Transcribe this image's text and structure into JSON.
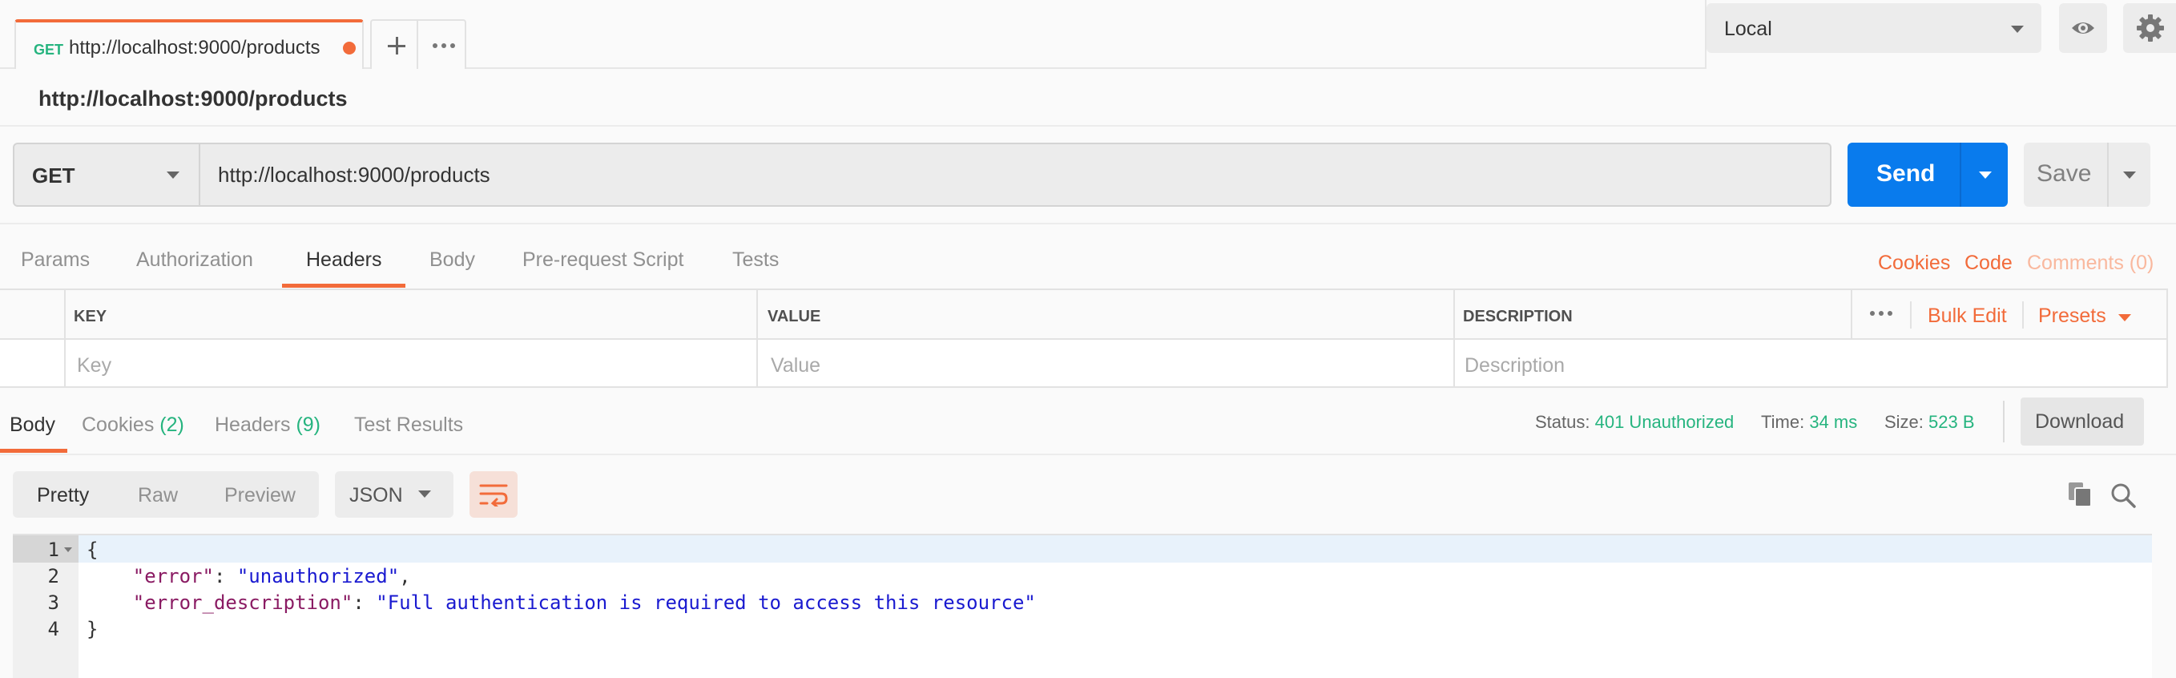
{
  "tab": {
    "method": "GET",
    "url": "http://localhost:9000/products"
  },
  "environment": {
    "selected": "Local"
  },
  "request": {
    "title": "http://localhost:9000/products",
    "method": "GET",
    "url": "http://localhost:9000/products",
    "send_label": "Send",
    "save_label": "Save"
  },
  "request_tabs": [
    "Params",
    "Authorization",
    "Headers",
    "Body",
    "Pre-request Script",
    "Tests"
  ],
  "request_links": {
    "cookies": "Cookies",
    "code": "Code",
    "comments": "Comments (0)"
  },
  "headers_table": {
    "columns": [
      "KEY",
      "VALUE",
      "DESCRIPTION"
    ],
    "placeholders": [
      "Key",
      "Value",
      "Description"
    ],
    "bulk_edit": "Bulk Edit",
    "presets": "Presets"
  },
  "response_tabs": {
    "body": "Body",
    "cookies": "Cookies",
    "cookies_count": "(2)",
    "headers": "Headers",
    "headers_count": "(9)",
    "tests": "Test Results"
  },
  "response_meta": {
    "status_label": "Status:",
    "status_value": "401 Unauthorized",
    "time_label": "Time:",
    "time_value": "34 ms",
    "size_label": "Size:",
    "size_value": "523 B",
    "download": "Download"
  },
  "view": {
    "options": [
      "Pretty",
      "Raw",
      "Preview"
    ],
    "format": "JSON"
  },
  "body_lines": {
    "n": [
      "1",
      "2",
      "3",
      "4"
    ],
    "open": "{",
    "close": "}",
    "k1": "\"error\"",
    "v1": "\"unauthorized\"",
    "k2": "\"error_description\"",
    "v2": "\"Full authentication is required to access this resource\""
  },
  "colors": {
    "accent": "#f26b3a",
    "send": "#097bed",
    "success": "#26b47f"
  }
}
